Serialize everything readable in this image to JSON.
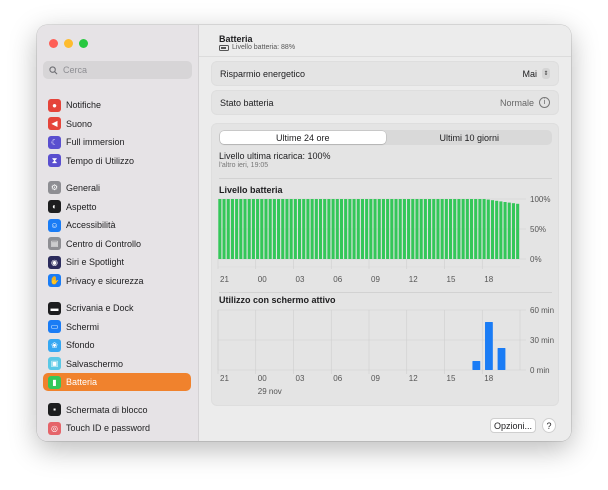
{
  "sidebar": {
    "search_placeholder": "Cerca",
    "groups": [
      [
        {
          "name": "sidebar-item-notifiche",
          "label": "Notifiche",
          "icon": "bell-icon",
          "color": "#e5443a",
          "glyph": "●"
        },
        {
          "name": "sidebar-item-suono",
          "label": "Suono",
          "icon": "speaker-icon",
          "color": "#e5443a",
          "glyph": "◀"
        },
        {
          "name": "sidebar-item-full-immersion",
          "label": "Full immersion",
          "icon": "moon-icon",
          "color": "#5a4fcf",
          "glyph": "☾"
        },
        {
          "name": "sidebar-item-tempo-di-utilizzo",
          "label": "Tempo di Utilizzo",
          "icon": "hourglass-icon",
          "color": "#5a4fcf",
          "glyph": "⧗"
        }
      ],
      [
        {
          "name": "sidebar-item-generali",
          "label": "Generali",
          "icon": "gear-icon",
          "color": "#8e8e93",
          "glyph": "⚙"
        },
        {
          "name": "sidebar-item-aspetto",
          "label": "Aspetto",
          "icon": "appearance-icon",
          "color": "#1d1d1f",
          "glyph": "◐"
        },
        {
          "name": "sidebar-item-accessibilita",
          "label": "Accessibilità",
          "icon": "accessibility-icon",
          "color": "#1a7cf5",
          "glyph": "☺"
        },
        {
          "name": "sidebar-item-centro-di-controllo",
          "label": "Centro di Controllo",
          "icon": "control-center-icon",
          "color": "#8e8e93",
          "glyph": "▤"
        },
        {
          "name": "sidebar-item-siri",
          "label": "Siri e Spotlight",
          "icon": "siri-icon",
          "color": "#2b2b5c",
          "glyph": "◉"
        },
        {
          "name": "sidebar-item-privacy",
          "label": "Privacy e sicurezza",
          "icon": "hand-icon",
          "color": "#1a7cf5",
          "glyph": "✋"
        }
      ],
      [
        {
          "name": "sidebar-item-scrivania-dock",
          "label": "Scrivania e Dock",
          "icon": "dock-icon",
          "color": "#1d1d1f",
          "glyph": "▬"
        },
        {
          "name": "sidebar-item-schermi",
          "label": "Schermi",
          "icon": "display-icon",
          "color": "#1a7cf5",
          "glyph": "▭"
        },
        {
          "name": "sidebar-item-sfondo",
          "label": "Sfondo",
          "icon": "wallpaper-icon",
          "color": "#35a7f2",
          "glyph": "❀"
        },
        {
          "name": "sidebar-item-salvaschermo",
          "label": "Salvaschermo",
          "icon": "screensaver-icon",
          "color": "#5ac8e6",
          "glyph": "▣"
        },
        {
          "name": "sidebar-item-batteria",
          "label": "Batteria",
          "icon": "battery-icon",
          "color": "#34c759",
          "glyph": "▮",
          "active": true
        }
      ],
      [
        {
          "name": "sidebar-item-schermata-di-blocco",
          "label": "Schermata di blocco",
          "icon": "lock-icon",
          "color": "#1d1d1f",
          "glyph": "▪"
        },
        {
          "name": "sidebar-item-touch-id",
          "label": "Touch ID e password",
          "icon": "fingerprint-icon",
          "color": "#e5646a",
          "glyph": "◎"
        }
      ]
    ]
  },
  "header": {
    "title": "Batteria",
    "subtitle": "Livello batteria: 88%"
  },
  "settings": {
    "energy_label": "Risparmio energetico",
    "energy_value": "Mai",
    "status_label": "Stato batteria",
    "status_value": "Normale"
  },
  "tabs": [
    "Ultime 24 ore",
    "Ultimi 10 giorni"
  ],
  "last_charge": {
    "label": "Livello ultima ricarica: 100%",
    "time": "l'altro ieri, 19:05"
  },
  "chart_data": [
    {
      "type": "bar",
      "title": "Livello batteria",
      "x_tick_labels": [
        "21",
        "00",
        "03",
        "06",
        "09",
        "12",
        "15",
        "18"
      ],
      "y_tick_labels": [
        "100%",
        "50%",
        "0%"
      ],
      "ylim": [
        0,
        100
      ],
      "bar_count": 72,
      "values_percent": [
        100,
        100,
        100,
        100,
        100,
        100,
        100,
        100,
        100,
        100,
        100,
        100,
        100,
        100,
        100,
        100,
        100,
        100,
        100,
        100,
        100,
        100,
        100,
        100,
        100,
        100,
        100,
        100,
        100,
        100,
        100,
        100,
        100,
        100,
        100,
        100,
        100,
        100,
        100,
        100,
        100,
        100,
        100,
        100,
        100,
        100,
        100,
        100,
        100,
        100,
        100,
        100,
        100,
        100,
        100,
        100,
        100,
        100,
        100,
        100,
        100,
        100,
        100,
        100,
        99,
        98,
        97,
        96,
        95,
        94,
        93,
        92
      ],
      "bar_color": "#34c759"
    },
    {
      "type": "bar",
      "title": "Utilizzo con schermo attivo",
      "x_tick_labels": [
        "21",
        "00",
        "03",
        "06",
        "09",
        "12",
        "15",
        "18"
      ],
      "x_sub_label": "29 nov",
      "y_tick_labels": [
        "60 min",
        "30 min",
        "0 min"
      ],
      "ylim": [
        0,
        60
      ],
      "bars": [
        {
          "hour_index": 20,
          "minutes": 9
        },
        {
          "hour_index": 21,
          "minutes": 48
        },
        {
          "hour_index": 22,
          "minutes": 22
        }
      ],
      "bar_color": "#1a7cf5"
    }
  ],
  "footer": {
    "options_label": "Opzioni...",
    "help_label": "?"
  },
  "colors": {
    "accent": "#f0822d",
    "close": "#fe5f57",
    "minimize": "#febc2e",
    "zoom": "#28c840"
  }
}
